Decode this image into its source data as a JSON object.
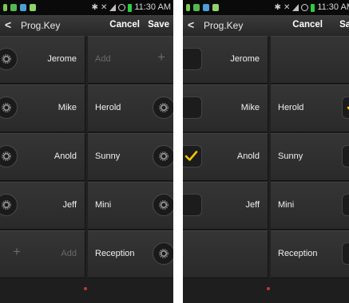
{
  "status": {
    "time": "11:30 AM"
  },
  "header": {
    "title": "Prog.Key",
    "cancel_label": "Cancel",
    "save_label": "Save"
  },
  "colors": {
    "check": "#f5c400",
    "gear": "#9a9a9a"
  },
  "edit_screen": {
    "rows": [
      {
        "left": "Jerome",
        "right": "Add"
      },
      {
        "left": "Mike",
        "right": "Herold"
      },
      {
        "left": "Anold",
        "right": "Sunny"
      },
      {
        "left": "Jeff",
        "right": "Mini"
      },
      {
        "left": "Add",
        "right": "Reception"
      }
    ]
  },
  "select_screen": {
    "rows": [
      {
        "left": "Jerome",
        "left_checked": false,
        "right": "",
        "right_checked": null
      },
      {
        "left": "Mike",
        "left_checked": false,
        "right": "Herold",
        "right_checked": true
      },
      {
        "left": "Anold",
        "left_checked": true,
        "right": "Sunny",
        "right_checked": false
      },
      {
        "left": "Jeff",
        "left_checked": false,
        "right": "Mini",
        "right_checked": false
      },
      {
        "left": "",
        "left_checked": null,
        "right": "Reception",
        "right_checked": false
      }
    ]
  }
}
